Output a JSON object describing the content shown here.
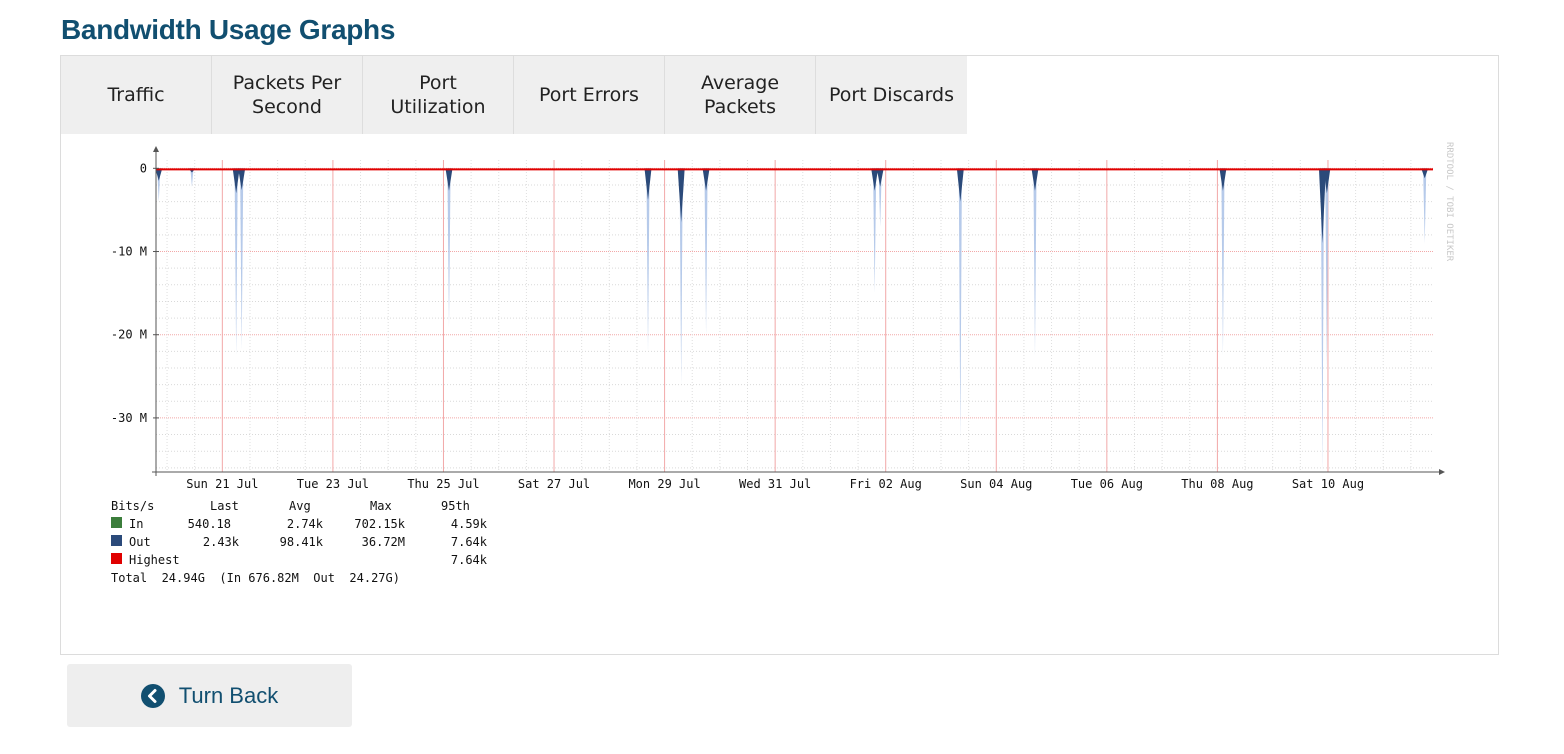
{
  "page": {
    "title": "Bandwidth Usage Graphs"
  },
  "tabs": [
    {
      "label": "Traffic",
      "active": true
    },
    {
      "label": "Packets Per Second",
      "active": false
    },
    {
      "label": "Port Utilization",
      "active": false
    },
    {
      "label": "Port Errors",
      "active": false
    },
    {
      "label": "Average Packets",
      "active": false
    },
    {
      "label": "Port Discards",
      "active": false
    }
  ],
  "graph": {
    "watermark": "RRDTOOL / TOBI OETIKER",
    "legend": {
      "header": [
        "Bits/s",
        "Last",
        "Avg",
        "Max",
        "95th"
      ],
      "rows": [
        {
          "name": "In",
          "color": "#3b7d3b",
          "last": "540.18",
          "avg": "2.74k",
          "max": "702.15k",
          "p95": "4.59k"
        },
        {
          "name": "Out",
          "color": "#2b4a7a",
          "last": "2.43k",
          "avg": "98.41k",
          "max": "36.72M",
          "p95": "7.64k"
        },
        {
          "name": "Highest",
          "color": "#e00000",
          "last": "",
          "avg": "",
          "max": "",
          "p95": "7.64k"
        }
      ],
      "total": "Total  24.94G  (In 676.82M  Out  24.27G)"
    }
  },
  "chart_data": {
    "type": "area",
    "title": "",
    "xlabel": "",
    "ylabel": "",
    "y_tick_labels": [
      "0",
      "-10 M",
      "-20 M",
      "-30 M"
    ],
    "y_ticks": [
      0,
      -10,
      -20,
      -30
    ],
    "ylim": [
      -36.5,
      1
    ],
    "x_tick_labels": [
      "Sun 21 Jul",
      "Tue 23 Jul",
      "Thu 25 Jul",
      "Sat 27 Jul",
      "Mon 29 Jul",
      "Wed 31 Jul",
      "Fri 02 Aug",
      "Sun 04 Aug",
      "Tue 06 Aug",
      "Thu 08 Aug",
      "Sat 10 Aug"
    ],
    "x_ticks": [
      1.0,
      3.0,
      5.0,
      7.0,
      9.0,
      11.0,
      13.0,
      15.0,
      17.0,
      19.0,
      21.0
    ],
    "xlim": [
      -0.2,
      22.9
    ],
    "grid": true,
    "series": [
      {
        "name": "Out",
        "color": "#2b4a7a",
        "fill": "#aec4e8",
        "spikes": [
          {
            "x": -0.15,
            "peak": -4.0,
            "avg": -1.5
          },
          {
            "x": 0.45,
            "peak": -2.2,
            "avg": -0.5
          },
          {
            "x": 1.25,
            "peak": -22.5,
            "avg": -3.0
          },
          {
            "x": 1.35,
            "peak": -21.8,
            "avg": -2.6
          },
          {
            "x": 5.1,
            "peak": -19.0,
            "avg": -2.7
          },
          {
            "x": 8.7,
            "peak": -22.0,
            "avg": -3.8
          },
          {
            "x": 9.3,
            "peak": -26.0,
            "avg": -6.5
          },
          {
            "x": 9.75,
            "peak": -20.0,
            "avg": -2.7
          },
          {
            "x": 12.8,
            "peak": -15.0,
            "avg": -2.7
          },
          {
            "x": 12.9,
            "peak": -7.0,
            "avg": -2.2
          },
          {
            "x": 14.35,
            "peak": -32.5,
            "avg": -4.0
          },
          {
            "x": 15.7,
            "peak": -22.5,
            "avg": -2.7
          },
          {
            "x": 19.1,
            "peak": -22.5,
            "avg": -2.7
          },
          {
            "x": 20.9,
            "peak": -36.5,
            "avg": -9.0
          },
          {
            "x": 20.98,
            "peak": -24.0,
            "avg": -3.0
          },
          {
            "x": 22.75,
            "peak": -9.0,
            "avg": -1.2
          }
        ]
      },
      {
        "name": "Highest",
        "color": "#e00000",
        "values": [
          0.0
        ]
      }
    ]
  }
}
